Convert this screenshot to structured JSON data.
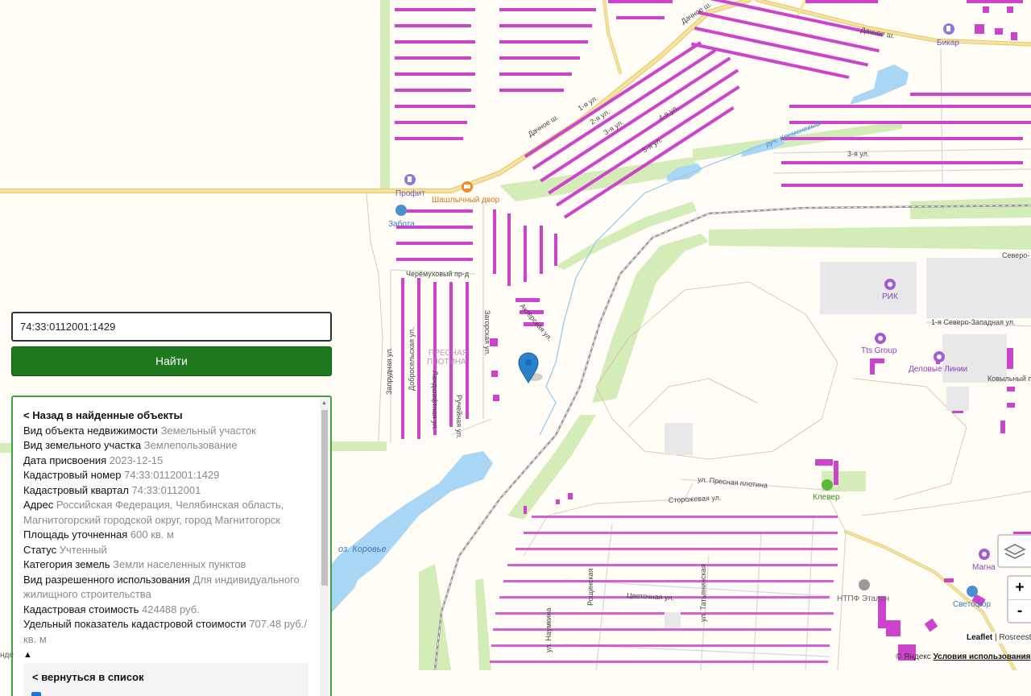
{
  "search": {
    "value": "74:33:0112001:1429",
    "button_label": "Найти"
  },
  "info": {
    "back_label": "< Назад в найденные объекты",
    "fields": [
      {
        "label": "Вид объекта недвижимости",
        "value": "Земельный участок"
      },
      {
        "label": "Вид земельного участка",
        "value": "Землепользование"
      },
      {
        "label": "Дата присвоения",
        "value": "2023-12-15"
      },
      {
        "label": "Кадастровый номер",
        "value": "74:33:0112001:1429"
      },
      {
        "label": "Кадастровый квартал",
        "value": "74:33:0112001"
      },
      {
        "label": "Адрес",
        "value": "Российская Федерация, Челябинская область, Магнитогорский городской округ, город Магнитогорск"
      },
      {
        "label": "Площадь уточненная",
        "value": "600 кв. м"
      },
      {
        "label": "Статус",
        "value": "Учтенный"
      },
      {
        "label": "Категория земель",
        "value": "Земли населенных пунктов"
      },
      {
        "label": "Вид разрешенного использования",
        "value": "Для индивидуального жилищного строительства"
      },
      {
        "label": "Кадастровая стоимость",
        "value": "424488 руб."
      },
      {
        "label": "Удельный показатель кадастровой стоимости",
        "value": "707.48 руб./кв. м"
      }
    ],
    "collapse_glyph": "▲",
    "sublist_back_label": "< вернуться в список"
  },
  "map": {
    "streets": {
      "dachnoe1": "Дачное ш.",
      "dachnoe2": "Дачное ш.",
      "dachnoe3": "Дачное ш.",
      "ul1": "1-я ул.",
      "ul2": "2-я ул.",
      "ul3": "3-я ул.",
      "ul4": "4-я ул.",
      "ul5": "5-я ул.",
      "ul3b": "3-я ул.",
      "cheremuh": "Черёмуховый пр-д",
      "zagorsk": "Загорская ул.",
      "aktersk": "Актёрская ул.",
      "dobroselsk": "Добросельская ул.",
      "zaprudn": "Запрудная ул.",
      "lanshaf": "Ландшафтная ул.",
      "ruch": "Ручейная ул.",
      "presnaya": "ул. Пресная плотина",
      "storozh": "Сторожевая ул.",
      "tsvet": "Цветочная ул.",
      "tatyan": "ул. Татьянинская",
      "roscha": "Рощинская",
      "naumkina": "ул. Наумкина",
      "sevzap": "1-я Северо-Западная ул.",
      "sever": "Северо-",
      "kovyl": "Ковыльный пр.",
      "kremen": "руч. Кременевый"
    },
    "places": {
      "presny1": "ПРЕСНАЯ",
      "presny2": "ПЛОТИНА",
      "lake": "оз. Коровье"
    },
    "pois": {
      "profit": "Профит",
      "shashlik": "Шашлычный двор",
      "zabota": "Забота",
      "bikar": "Бикар",
      "rik": "РИК",
      "tts": "Tts Group",
      "delovye": "Деловые Линии",
      "klever": "Клевер",
      "magna": "Магна",
      "ntpf": "НТПФ Эталон",
      "svetofor": "Светофор"
    },
    "colors": {
      "background": "#fffdf5",
      "building": "#cc44cc",
      "water": "#a9d6f5",
      "park": "#d4ecb8",
      "road": "#f8e39a",
      "marker": "#2a81cb",
      "search_button": "#1f7a1f",
      "panel_border": "#3ba53b"
    }
  },
  "attribution": {
    "leaflet": "Leaflet",
    "sep": " | ",
    "rosreestr": "Rosreestr",
    "yandex": "© Яндекс ",
    "terms": "Условия использования",
    "left_stub": "нде"
  },
  "controls": {
    "zoom_in": "+",
    "zoom_out": "-",
    "layers_icon": "layers-icon"
  }
}
